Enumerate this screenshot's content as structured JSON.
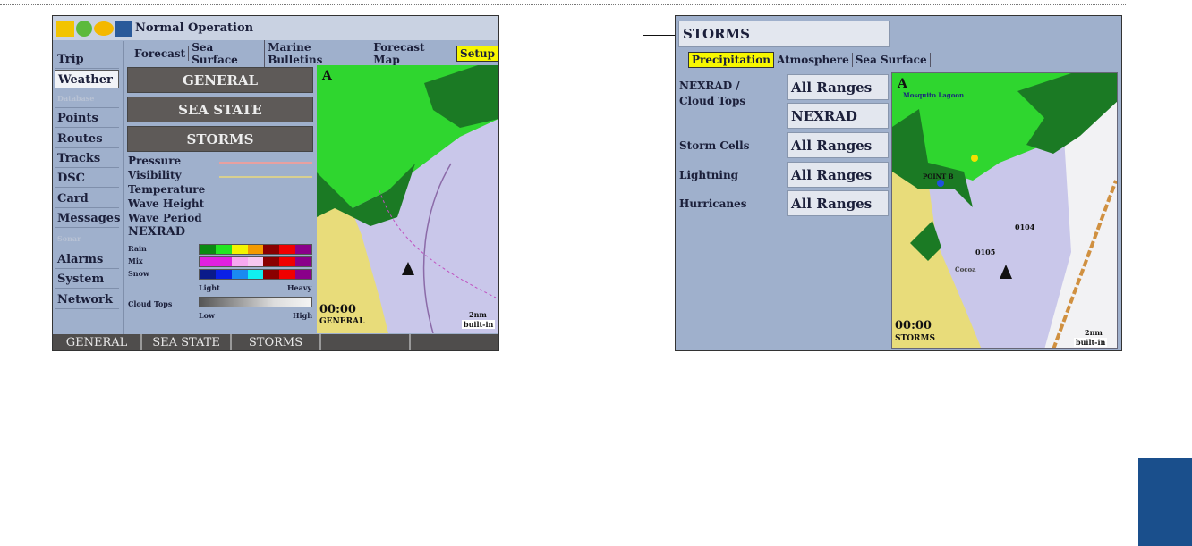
{
  "left_screen": {
    "title": "Normal Operation",
    "status_icons": [
      "gps-icon",
      "signal-icon",
      "weather-icon",
      "battery-icon"
    ],
    "tabs": [
      "Forecast",
      "Sea Surface",
      "Marine Bulletins",
      "Forecast Map",
      "Setup"
    ],
    "active_tab": "Setup",
    "sidebar": [
      "Trip",
      "Weather",
      "Database",
      "Points",
      "Routes",
      "Tracks",
      "DSC",
      "Card",
      "Messages",
      "Sonar",
      "Alarms",
      "System",
      "Network"
    ],
    "sidebar_selected": "Weather",
    "buttons": [
      "GENERAL",
      "SEA STATE",
      "STORMS"
    ],
    "legend_items": [
      "Pressure",
      "Visibility",
      "Temperature",
      "Wave Height",
      "Wave Period",
      "NEXRAD"
    ],
    "nexrad_rows": [
      "Rain",
      "Mix",
      "Snow"
    ],
    "light_label": "Light",
    "heavy_label": "Heavy",
    "cloud_tops_label": "Cloud Tops",
    "low_label": "Low",
    "high_label": "High",
    "map_time": "00:00",
    "map_mode": "GENERAL",
    "map_scale": "2nm",
    "map_source": "built-in",
    "bottom_bar": [
      "GENERAL",
      "SEA STATE",
      "STORMS",
      "",
      ""
    ],
    "colors": {
      "rain": [
        "#0a8a12",
        "#22e622",
        "#f4f400",
        "#f49a00",
        "#8a0000",
        "#f00000",
        "#8a008a"
      ],
      "mix": [
        "#e020e0",
        "#e020e0",
        "#f7a8f0",
        "#f7c8f0",
        "#8a0000",
        "#f00000",
        "#8a008a"
      ],
      "snow": [
        "#0a1a8a",
        "#0a20e6",
        "#1a8af0",
        "#10f0f0",
        "#8a0000",
        "#f00000",
        "#8a008a"
      ]
    }
  },
  "right_screen": {
    "title": "STORMS",
    "tabs": [
      "Precipitation",
      "Atmosphere",
      "Sea Surface"
    ],
    "active_tab": "Precipitation",
    "settings": [
      {
        "label": "NEXRAD / Cloud Tops",
        "values": [
          "All Ranges",
          "NEXRAD"
        ]
      },
      {
        "label": "Storm Cells",
        "values": [
          "All Ranges"
        ]
      },
      {
        "label": "Lightning",
        "values": [
          "All Ranges"
        ]
      },
      {
        "label": "Hurricanes",
        "values": [
          "All Ranges"
        ]
      }
    ],
    "map_labels": {
      "place1": "Mosquito Lagoon",
      "place2": "POINT B",
      "place3": "Cocoa",
      "place4": "0104",
      "place5": "0105"
    },
    "map_time": "00:00",
    "map_mode": "STORMS",
    "map_scale": "2nm",
    "map_source": "built-in"
  }
}
